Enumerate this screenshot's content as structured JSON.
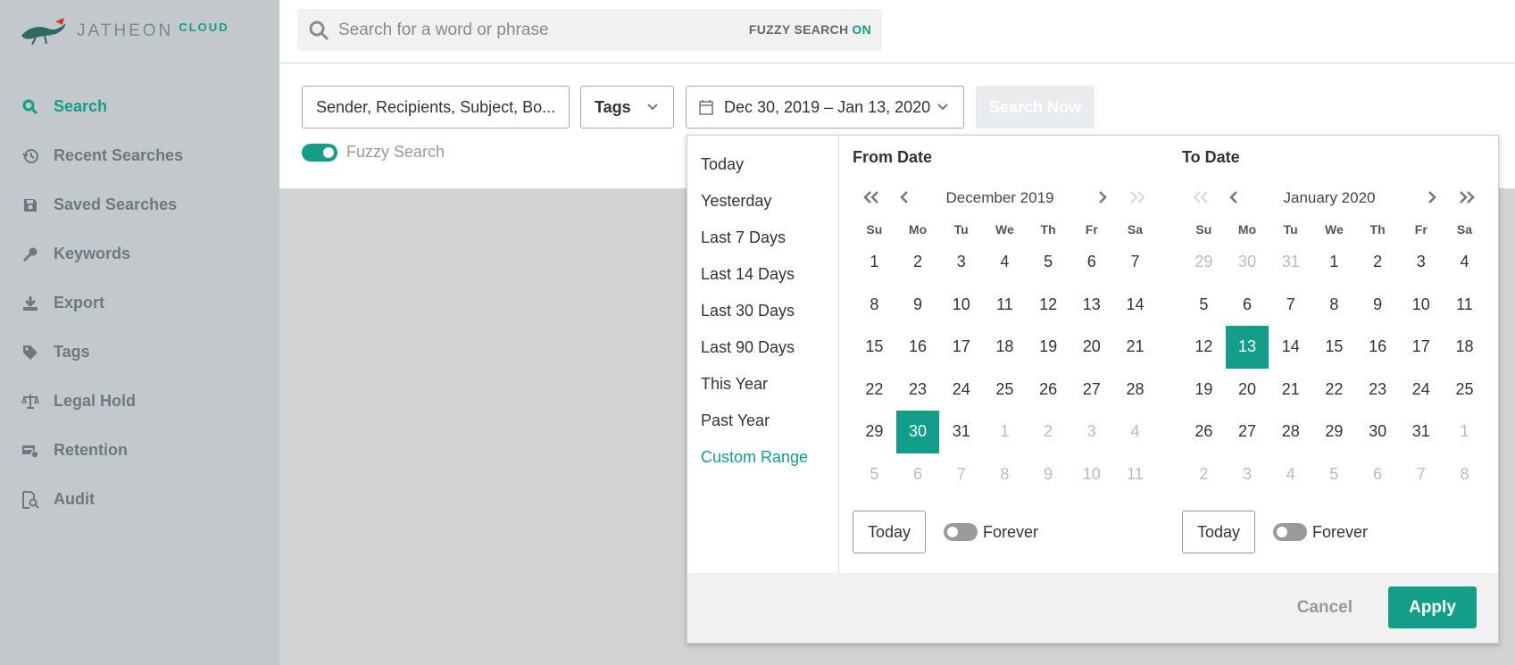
{
  "brand": {
    "name": "JATHEON",
    "suffix": "CLOUD"
  },
  "sidebar": {
    "items": [
      {
        "label": "Search",
        "icon": "search-icon",
        "active": true
      },
      {
        "label": "Recent Searches",
        "icon": "history-icon"
      },
      {
        "label": "Saved Searches",
        "icon": "save-icon"
      },
      {
        "label": "Keywords",
        "icon": "key-icon"
      },
      {
        "label": "Export",
        "icon": "download-icon"
      },
      {
        "label": "Tags",
        "icon": "tag-icon"
      },
      {
        "label": "Legal Hold",
        "icon": "scales-icon"
      },
      {
        "label": "Retention",
        "icon": "retention-icon"
      },
      {
        "label": "Audit",
        "icon": "audit-icon"
      }
    ]
  },
  "search": {
    "placeholder": "Search for a word or phrase",
    "fuzzy_label": "FUZZY SEARCH",
    "fuzzy_state": "ON"
  },
  "filters": {
    "fields_value": "Sender, Recipients, Subject, Bo...",
    "tags_label": "Tags",
    "date_range": "Dec 30, 2019 – Jan 13, 2020",
    "search_now": "Search Now",
    "fuzzy_toggle_label": "Fuzzy Search",
    "fuzzy_toggle_on": true
  },
  "picker": {
    "ranges": [
      "Today",
      "Yesterday",
      "Last 7 Days",
      "Last 14 Days",
      "Last 30 Days",
      "Last 90 Days",
      "This Year",
      "Past Year",
      "Custom Range"
    ],
    "active_range": "Custom Range",
    "weekdays": [
      "Su",
      "Mo",
      "Tu",
      "We",
      "Th",
      "Fr",
      "Sa"
    ],
    "from": {
      "title": "From Date",
      "month": "December 2019",
      "days": [
        [
          "1",
          "2",
          "3",
          "4",
          "5",
          "6",
          "7"
        ],
        [
          "8",
          "9",
          "10",
          "11",
          "12",
          "13",
          "14"
        ],
        [
          "15",
          "16",
          "17",
          "18",
          "19",
          "20",
          "21"
        ],
        [
          "22",
          "23",
          "24",
          "25",
          "26",
          "27",
          "28"
        ],
        [
          "29",
          "30",
          "31",
          "1",
          "2",
          "3",
          "4"
        ],
        [
          "5",
          "6",
          "7",
          "8",
          "9",
          "10",
          "11"
        ]
      ],
      "muted_from_index": 31,
      "selected_index": 29,
      "today_label": "Today",
      "forever_label": "Forever"
    },
    "to": {
      "title": "To Date",
      "month": "January 2020",
      "days": [
        [
          "29",
          "30",
          "31",
          "1",
          "2",
          "3",
          "4"
        ],
        [
          "5",
          "6",
          "7",
          "8",
          "9",
          "10",
          "11"
        ],
        [
          "12",
          "13",
          "14",
          "15",
          "16",
          "17",
          "18"
        ],
        [
          "19",
          "20",
          "21",
          "22",
          "23",
          "24",
          "25"
        ],
        [
          "26",
          "27",
          "28",
          "29",
          "30",
          "31",
          "1"
        ],
        [
          "2",
          "3",
          "4",
          "5",
          "6",
          "7",
          "8"
        ]
      ],
      "muted_before_index": 3,
      "muted_from_index": 34,
      "selected_index": 15,
      "today_label": "Today",
      "forever_label": "Forever"
    },
    "cancel_label": "Cancel",
    "apply_label": "Apply"
  },
  "colors": {
    "accent": "#139e89",
    "sidebar_bg": "#c2c8cb"
  }
}
